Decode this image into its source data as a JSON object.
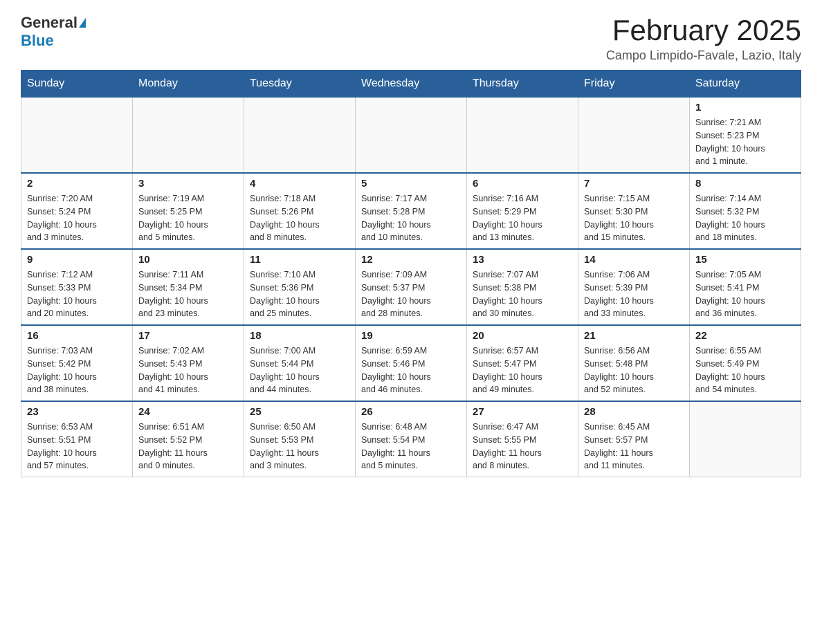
{
  "logo": {
    "general": "General",
    "blue": "Blue"
  },
  "title": "February 2025",
  "subtitle": "Campo Limpido-Favale, Lazio, Italy",
  "days_header": [
    "Sunday",
    "Monday",
    "Tuesday",
    "Wednesday",
    "Thursday",
    "Friday",
    "Saturday"
  ],
  "weeks": [
    [
      {
        "day": "",
        "info": ""
      },
      {
        "day": "",
        "info": ""
      },
      {
        "day": "",
        "info": ""
      },
      {
        "day": "",
        "info": ""
      },
      {
        "day": "",
        "info": ""
      },
      {
        "day": "",
        "info": ""
      },
      {
        "day": "1",
        "info": "Sunrise: 7:21 AM\nSunset: 5:23 PM\nDaylight: 10 hours\nand 1 minute."
      }
    ],
    [
      {
        "day": "2",
        "info": "Sunrise: 7:20 AM\nSunset: 5:24 PM\nDaylight: 10 hours\nand 3 minutes."
      },
      {
        "day": "3",
        "info": "Sunrise: 7:19 AM\nSunset: 5:25 PM\nDaylight: 10 hours\nand 5 minutes."
      },
      {
        "day": "4",
        "info": "Sunrise: 7:18 AM\nSunset: 5:26 PM\nDaylight: 10 hours\nand 8 minutes."
      },
      {
        "day": "5",
        "info": "Sunrise: 7:17 AM\nSunset: 5:28 PM\nDaylight: 10 hours\nand 10 minutes."
      },
      {
        "day": "6",
        "info": "Sunrise: 7:16 AM\nSunset: 5:29 PM\nDaylight: 10 hours\nand 13 minutes."
      },
      {
        "day": "7",
        "info": "Sunrise: 7:15 AM\nSunset: 5:30 PM\nDaylight: 10 hours\nand 15 minutes."
      },
      {
        "day": "8",
        "info": "Sunrise: 7:14 AM\nSunset: 5:32 PM\nDaylight: 10 hours\nand 18 minutes."
      }
    ],
    [
      {
        "day": "9",
        "info": "Sunrise: 7:12 AM\nSunset: 5:33 PM\nDaylight: 10 hours\nand 20 minutes."
      },
      {
        "day": "10",
        "info": "Sunrise: 7:11 AM\nSunset: 5:34 PM\nDaylight: 10 hours\nand 23 minutes."
      },
      {
        "day": "11",
        "info": "Sunrise: 7:10 AM\nSunset: 5:36 PM\nDaylight: 10 hours\nand 25 minutes."
      },
      {
        "day": "12",
        "info": "Sunrise: 7:09 AM\nSunset: 5:37 PM\nDaylight: 10 hours\nand 28 minutes."
      },
      {
        "day": "13",
        "info": "Sunrise: 7:07 AM\nSunset: 5:38 PM\nDaylight: 10 hours\nand 30 minutes."
      },
      {
        "day": "14",
        "info": "Sunrise: 7:06 AM\nSunset: 5:39 PM\nDaylight: 10 hours\nand 33 minutes."
      },
      {
        "day": "15",
        "info": "Sunrise: 7:05 AM\nSunset: 5:41 PM\nDaylight: 10 hours\nand 36 minutes."
      }
    ],
    [
      {
        "day": "16",
        "info": "Sunrise: 7:03 AM\nSunset: 5:42 PM\nDaylight: 10 hours\nand 38 minutes."
      },
      {
        "day": "17",
        "info": "Sunrise: 7:02 AM\nSunset: 5:43 PM\nDaylight: 10 hours\nand 41 minutes."
      },
      {
        "day": "18",
        "info": "Sunrise: 7:00 AM\nSunset: 5:44 PM\nDaylight: 10 hours\nand 44 minutes."
      },
      {
        "day": "19",
        "info": "Sunrise: 6:59 AM\nSunset: 5:46 PM\nDaylight: 10 hours\nand 46 minutes."
      },
      {
        "day": "20",
        "info": "Sunrise: 6:57 AM\nSunset: 5:47 PM\nDaylight: 10 hours\nand 49 minutes."
      },
      {
        "day": "21",
        "info": "Sunrise: 6:56 AM\nSunset: 5:48 PM\nDaylight: 10 hours\nand 52 minutes."
      },
      {
        "day": "22",
        "info": "Sunrise: 6:55 AM\nSunset: 5:49 PM\nDaylight: 10 hours\nand 54 minutes."
      }
    ],
    [
      {
        "day": "23",
        "info": "Sunrise: 6:53 AM\nSunset: 5:51 PM\nDaylight: 10 hours\nand 57 minutes."
      },
      {
        "day": "24",
        "info": "Sunrise: 6:51 AM\nSunset: 5:52 PM\nDaylight: 11 hours\nand 0 minutes."
      },
      {
        "day": "25",
        "info": "Sunrise: 6:50 AM\nSunset: 5:53 PM\nDaylight: 11 hours\nand 3 minutes."
      },
      {
        "day": "26",
        "info": "Sunrise: 6:48 AM\nSunset: 5:54 PM\nDaylight: 11 hours\nand 5 minutes."
      },
      {
        "day": "27",
        "info": "Sunrise: 6:47 AM\nSunset: 5:55 PM\nDaylight: 11 hours\nand 8 minutes."
      },
      {
        "day": "28",
        "info": "Sunrise: 6:45 AM\nSunset: 5:57 PM\nDaylight: 11 hours\nand 11 minutes."
      },
      {
        "day": "",
        "info": ""
      }
    ]
  ]
}
